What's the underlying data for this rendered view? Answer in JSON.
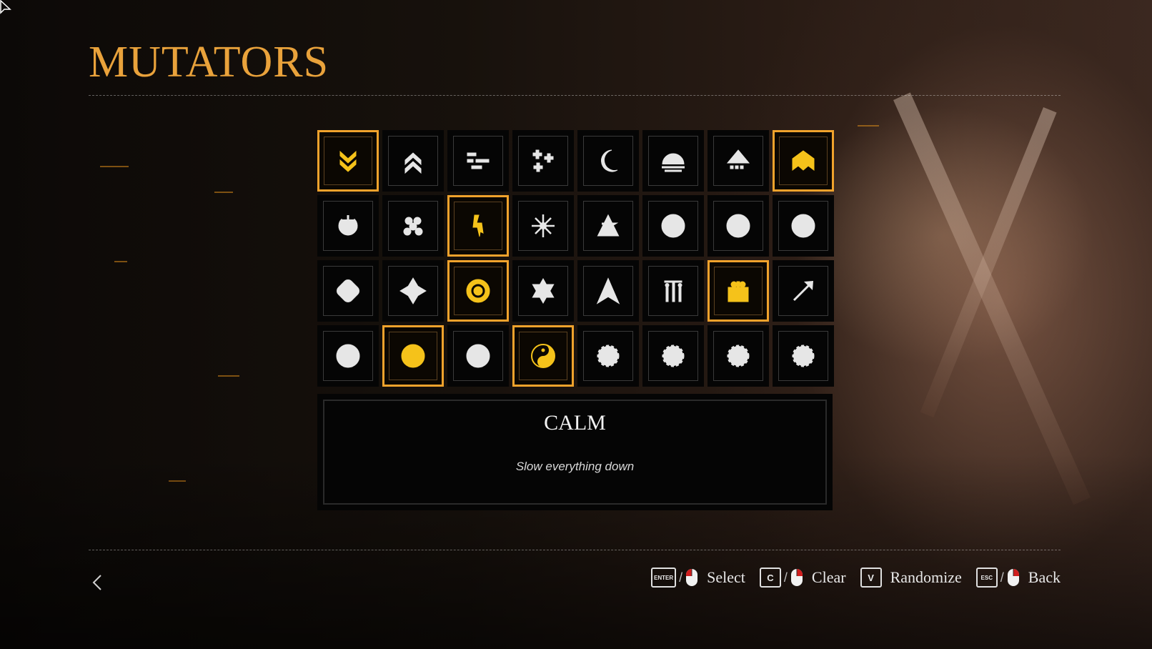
{
  "title": "MUTATORS",
  "grid": {
    "rows": [
      [
        {
          "name": "chevrons-down-icon",
          "selected": true
        },
        {
          "name": "chevrons-up-icon",
          "selected": false
        },
        {
          "name": "dashes-icon",
          "selected": false
        },
        {
          "name": "crosses-icon",
          "selected": false
        },
        {
          "name": "crescent-moon-icon",
          "selected": false
        },
        {
          "name": "sunrise-icon",
          "selected": false
        },
        {
          "name": "house-dotted-icon",
          "selected": false
        },
        {
          "name": "house-solid-icon",
          "selected": true
        }
      ],
      [
        {
          "name": "power-icon",
          "selected": false
        },
        {
          "name": "dots-cluster-icon",
          "selected": false
        },
        {
          "name": "lightning-icon",
          "selected": true
        },
        {
          "name": "burst-icon",
          "selected": false
        },
        {
          "name": "triangle-zigzag-icon",
          "selected": false
        },
        {
          "name": "circle-cross-icon",
          "selected": false
        },
        {
          "name": "circle-no-dodge-icon",
          "selected": false
        },
        {
          "name": "circle-no-ability-icon",
          "selected": false
        }
      ],
      [
        {
          "name": "rounded-square-icon",
          "selected": false
        },
        {
          "name": "star-square-icon",
          "selected": false
        },
        {
          "name": "flower-badge-icon",
          "selected": true
        },
        {
          "name": "star-of-david-icon",
          "selected": false
        },
        {
          "name": "arrowhead-icon",
          "selected": false
        },
        {
          "name": "pillars-icon",
          "selected": false
        },
        {
          "name": "gift-icon",
          "selected": true
        },
        {
          "name": "arrow-icon",
          "selected": false
        }
      ],
      [
        {
          "name": "happy-face-icon",
          "selected": false
        },
        {
          "name": "surprised-face-icon",
          "selected": true
        },
        {
          "name": "sad-face-icon",
          "selected": false
        },
        {
          "name": "yin-yang-icon",
          "selected": true
        },
        {
          "name": "gear-star-icon",
          "selected": false
        },
        {
          "name": "gear-lines-icon",
          "selected": false
        },
        {
          "name": "gear-ring-icon",
          "selected": false
        },
        {
          "name": "gear-x-icon",
          "selected": false
        }
      ]
    ]
  },
  "description": {
    "title": "CALM",
    "text": "Slow everything down"
  },
  "hints": {
    "select": {
      "key": "ENTER",
      "label": "Select"
    },
    "clear": {
      "key": "C",
      "label": "Clear"
    },
    "randomize": {
      "key": "V",
      "label": "Randomize"
    },
    "back": {
      "key": "ESC",
      "label": "Back"
    }
  },
  "colors": {
    "accent": "#e9a23b",
    "selected_border": "#f0a22c",
    "selected_icon": "#f5c21a"
  }
}
